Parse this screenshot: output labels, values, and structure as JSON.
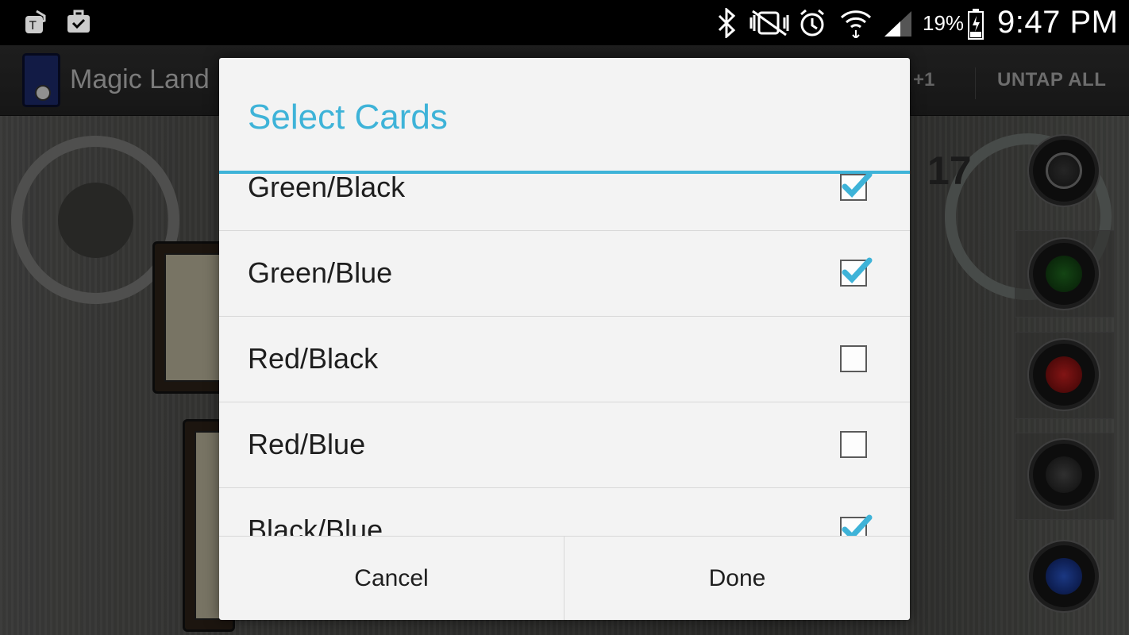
{
  "status_bar": {
    "battery_percent": "19%",
    "time": "9:47 PM",
    "icons": [
      "tmobile-icon",
      "briefcase-check-icon",
      "bluetooth-icon",
      "vibrate-mute-icon",
      "alarm-icon",
      "wifi-icon",
      "signal-icon",
      "battery-icon"
    ]
  },
  "action_bar": {
    "app_title": "Magic Land",
    "plus_one": "+1",
    "untap_all": "UNTAP ALL"
  },
  "board": {
    "land_count": "17",
    "mana_buttons": [
      "white-mana-icon",
      "green-mana-icon",
      "red-mana-icon",
      "black-mana-icon",
      "blue-mana-icon"
    ]
  },
  "dialog": {
    "title": "Select Cards",
    "items": [
      {
        "label": "Green/Black",
        "checked": true
      },
      {
        "label": "Green/Blue",
        "checked": true
      },
      {
        "label": "Red/Black",
        "checked": false
      },
      {
        "label": "Red/Blue",
        "checked": false
      },
      {
        "label": "Black/Blue",
        "checked": true
      }
    ],
    "cancel_label": "Cancel",
    "done_label": "Done"
  },
  "colors": {
    "accent": "#3eb3d8",
    "dialog_bg": "#f3f3f3",
    "status_bar_bg": "#000000"
  }
}
